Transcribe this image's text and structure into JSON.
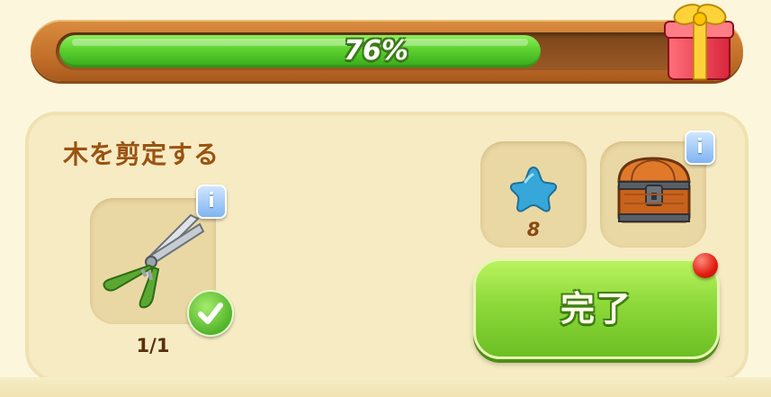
{
  "progress": {
    "fraction": 0.76,
    "label": "76%"
  },
  "task": {
    "title": "木を剪定する",
    "tool": {
      "icon": "pruning-shears-icon",
      "count": "1/1",
      "completed": true
    }
  },
  "rewards": [
    {
      "icon": "blue-star-icon",
      "count": "8"
    },
    {
      "icon": "treasure-chest-icon",
      "count": ""
    }
  ],
  "info_badge_label": "i",
  "complete_button": {
    "label": "完了"
  },
  "colors": {
    "progress_fill": "#5cd12f",
    "button_green": "#8dd93a",
    "title_brown": "#9a5312",
    "notify_red": "#e01c10"
  }
}
